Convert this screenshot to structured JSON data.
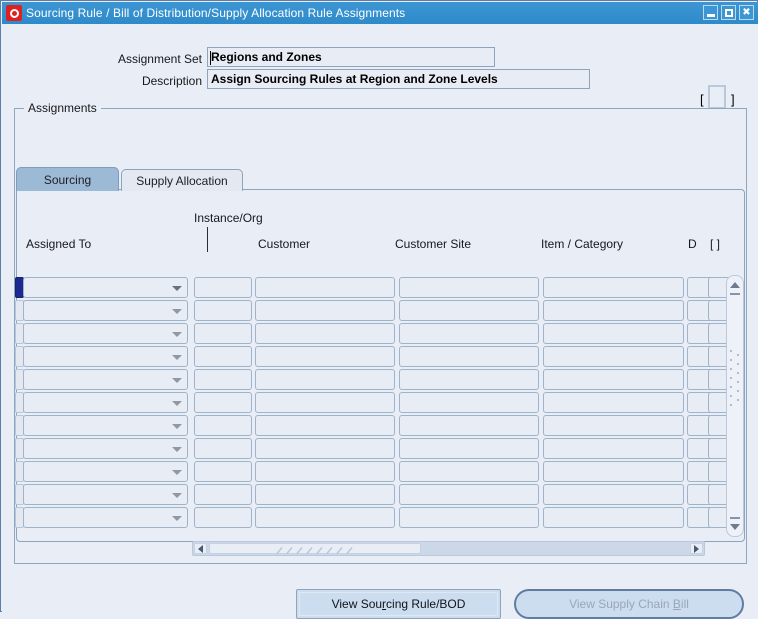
{
  "window": {
    "title": "Sourcing Rule / Bill of Distribution/Supply Allocation Rule Assignments",
    "logo_icon": "oracle-logo-icon",
    "minimize_label": "Minimize",
    "maximize_label": "Maximize",
    "close_label": "Close",
    "close_glyph": "✖"
  },
  "header": {
    "assignment_set_label": "Assignment Set",
    "assignment_set_value": "Regions and Zones",
    "assignment_set_placeholder": "",
    "description_label": "Description",
    "description_value": "Assign Sourcing Rules at Region and Zone Levels",
    "description_placeholder": "",
    "bracket_open": "[",
    "bracket_close": "]"
  },
  "group": {
    "assignments_label": "Assignments"
  },
  "tabs": [
    {
      "label": "Sourcing",
      "active": true
    },
    {
      "label": "Supply Allocation",
      "active": false
    }
  ],
  "grid": {
    "columns": [
      {
        "key": "assigned_to",
        "label": "Assigned To",
        "type": "dropdown"
      },
      {
        "key": "instance_org",
        "label": "Instance/Org",
        "type": "text"
      },
      {
        "key": "customer",
        "label": "Customer",
        "type": "text"
      },
      {
        "key": "customer_site",
        "label": "Customer Site",
        "type": "text"
      },
      {
        "key": "item_category",
        "label": "Item / Category",
        "type": "text"
      },
      {
        "key": "d",
        "label": "D",
        "type": "text"
      },
      {
        "key": "flag",
        "label": "[ ]",
        "type": "checkbox"
      }
    ],
    "rows": [
      {
        "assigned_to": "",
        "instance_org": "",
        "customer": "",
        "customer_site": "",
        "item_category": "",
        "d": "",
        "flag": "",
        "current": true
      },
      {
        "assigned_to": "",
        "instance_org": "",
        "customer": "",
        "customer_site": "",
        "item_category": "",
        "d": "",
        "flag": "",
        "current": false
      },
      {
        "assigned_to": "",
        "instance_org": "",
        "customer": "",
        "customer_site": "",
        "item_category": "",
        "d": "",
        "flag": "",
        "current": false
      },
      {
        "assigned_to": "",
        "instance_org": "",
        "customer": "",
        "customer_site": "",
        "item_category": "",
        "d": "",
        "flag": "",
        "current": false
      },
      {
        "assigned_to": "",
        "instance_org": "",
        "customer": "",
        "customer_site": "",
        "item_category": "",
        "d": "",
        "flag": "",
        "current": false
      },
      {
        "assigned_to": "",
        "instance_org": "",
        "customer": "",
        "customer_site": "",
        "item_category": "",
        "d": "",
        "flag": "",
        "current": false
      },
      {
        "assigned_to": "",
        "instance_org": "",
        "customer": "",
        "customer_site": "",
        "item_category": "",
        "d": "",
        "flag": "",
        "current": false
      },
      {
        "assigned_to": "",
        "instance_org": "",
        "customer": "",
        "customer_site": "",
        "item_category": "",
        "d": "",
        "flag": "",
        "current": false
      },
      {
        "assigned_to": "",
        "instance_org": "",
        "customer": "",
        "customer_site": "",
        "item_category": "",
        "d": "",
        "flag": "",
        "current": false
      },
      {
        "assigned_to": "",
        "instance_org": "",
        "customer": "",
        "customer_site": "",
        "item_category": "",
        "d": "",
        "flag": "",
        "current": false
      },
      {
        "assigned_to": "",
        "instance_org": "",
        "customer": "",
        "customer_site": "",
        "item_category": "",
        "d": "",
        "flag": "",
        "current": false
      }
    ],
    "vertical_scrollbar": {
      "up_icon": "scroll-up-arrow-icon",
      "down_icon": "scroll-down-arrow-icon",
      "position": "top"
    },
    "horizontal_scrollbar": {
      "left_icon": "scroll-left-arrow-icon",
      "right_icon": "scroll-right-arrow-icon",
      "thumb_fraction": 0.44
    }
  },
  "footer": {
    "view_sourcing_rule_pre": "View Sou",
    "view_sourcing_rule_mnemonic": "r",
    "view_sourcing_rule_post": "cing Rule/BOD",
    "view_sourcing_rule_label": "View Sourcing Rule/BOD",
    "view_supply_chain_pre": "View Supply Chain ",
    "view_supply_chain_mnemonic": "B",
    "view_supply_chain_post": "ill",
    "view_supply_chain_label": "View Supply Chain Bill",
    "view_supply_chain_enabled": false
  },
  "colors": {
    "titlebar": "#2f8ac9",
    "canvas": "#e9edf5",
    "field": "#e8ecf4",
    "tab_active": "#9cb9d6",
    "tab_inactive": "#e3e8f1",
    "current_row_marker": "#1c2a8f",
    "button": "#ccddf0",
    "border": "#8ea4bd"
  }
}
